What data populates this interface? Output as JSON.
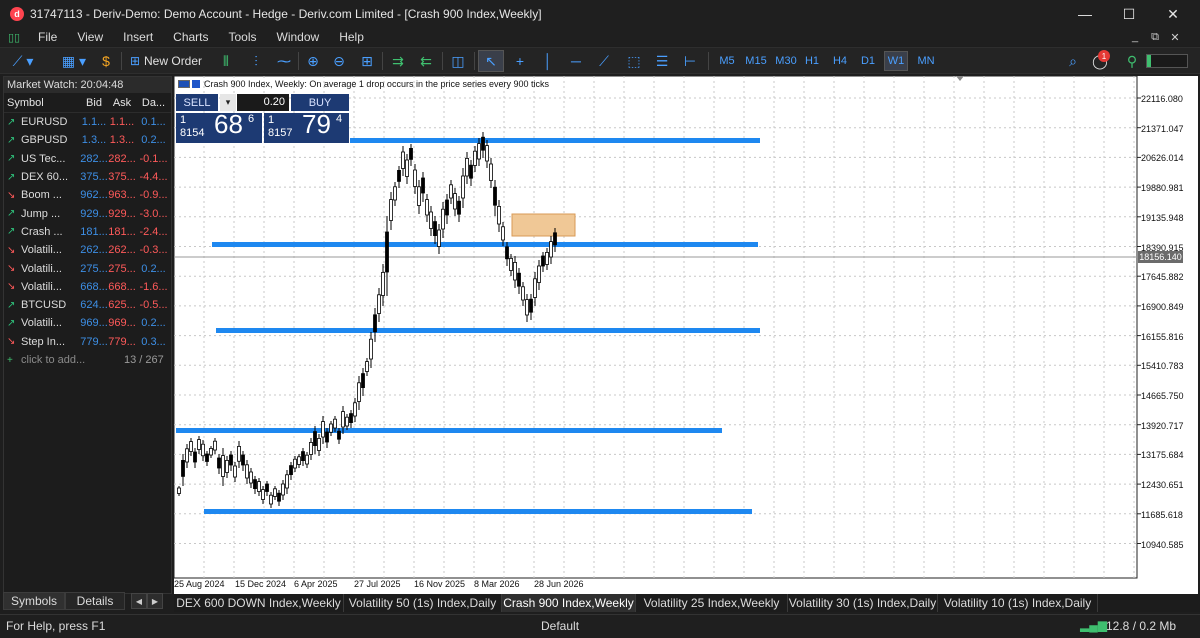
{
  "window": {
    "title": "31747113 - Deriv-Demo: Demo Account - Hedge - Deriv.com Limited - [Crash 900 Index,Weekly]",
    "logo": "d",
    "minimize": "—",
    "maximize": "☐",
    "close": "✕"
  },
  "menu": {
    "items": [
      "File",
      "View",
      "Insert",
      "Charts",
      "Tools",
      "Window",
      "Help"
    ],
    "mdi_minimize": "_",
    "mdi_restore": "⧉",
    "mdi_close": "✕"
  },
  "toolbar": {
    "new_order_label": "New Order",
    "timeframes": [
      "M5",
      "M15",
      "M30",
      "H1",
      "H4",
      "D1",
      "W1",
      "MN"
    ],
    "active_timeframe": "W1",
    "notification_count": "1"
  },
  "market_watch": {
    "title": "Market Watch: 20:04:48",
    "columns": [
      "Symbol",
      "Bid",
      "Ask",
      "Da..."
    ],
    "rows": [
      {
        "symbol": "EURUSD",
        "bid": "1.1...",
        "ask": "1.1...",
        "daily": "0.1...",
        "dir": "up"
      },
      {
        "symbol": "GBPUSD",
        "bid": "1.3...",
        "ask": "1.3...",
        "daily": "0.2...",
        "dir": "up"
      },
      {
        "symbol": "US Tec...",
        "bid": "282...",
        "ask": "282...",
        "daily": "-0.1...",
        "dir": "up"
      },
      {
        "symbol": "DEX 60...",
        "bid": "375...",
        "ask": "375...",
        "daily": "-4.4...",
        "dir": "up"
      },
      {
        "symbol": "Boom ...",
        "bid": "962...",
        "ask": "963...",
        "daily": "-0.9...",
        "dir": "down"
      },
      {
        "symbol": "Jump ...",
        "bid": "929...",
        "ask": "929...",
        "daily": "-3.0...",
        "dir": "up"
      },
      {
        "symbol": "Crash ...",
        "bid": "181...",
        "ask": "181...",
        "daily": "-2.4...",
        "dir": "up"
      },
      {
        "symbol": "Volatili...",
        "bid": "262...",
        "ask": "262...",
        "daily": "-0.3...",
        "dir": "down"
      },
      {
        "symbol": "Volatili...",
        "bid": "275...",
        "ask": "275...",
        "daily": "0.2...",
        "dir": "down"
      },
      {
        "symbol": "Volatili...",
        "bid": "668...",
        "ask": "668...",
        "daily": "-1.6...",
        "dir": "down"
      },
      {
        "symbol": "BTCUSD",
        "bid": "624...",
        "ask": "625...",
        "daily": "-0.5...",
        "dir": "up"
      },
      {
        "symbol": "Volatili...",
        "bid": "969...",
        "ask": "969...",
        "daily": "0.2...",
        "dir": "up"
      },
      {
        "symbol": "Step In...",
        "bid": "779...",
        "ask": "779...",
        "daily": "0.3...",
        "dir": "down"
      }
    ],
    "add_symbol": "click to add...",
    "count": "13 / 267",
    "tabs": [
      "Symbols",
      "Details"
    ]
  },
  "chart": {
    "info": "Crash 900 Index, Weekly:  On average 1 drop occurs in the price series every 900 ticks",
    "sell_label": "SELL",
    "buy_label": "BUY",
    "volume": "0.20",
    "sell_price": {
      "small_top": "1",
      "small_bottom": "8154",
      "big": "68",
      "sup": "6"
    },
    "buy_price": {
      "small_top": "1",
      "small_bottom": "8157",
      "big": "79",
      "sup": "4"
    },
    "current_price": "18156.140",
    "price_levels": [
      "22116.080",
      "21371.047",
      "20626.014",
      "19880.981",
      "19135.948",
      "18390.915",
      "17645.882",
      "16900.849",
      "16155.816",
      "15410.783",
      "14665.750",
      "13920.717",
      "13175.684",
      "12430.651",
      "11685.618",
      "10940.585"
    ],
    "dates": [
      "25 Aug 2024",
      "15 Dec 2024",
      "6 Apr 2025",
      "27 Jul 2025",
      "16 Nov 2025",
      "8 Mar 2026",
      "28 Jun 2026"
    ],
    "colors": {
      "level_line": "#1e88f0",
      "zone": "#f0c896",
      "candle": "#000000"
    }
  },
  "chart_tabs": [
    "DEX 600 DOWN Index,Weekly",
    "Volatility 50 (1s) Index,Daily",
    "Crash 900 Index,Weekly",
    "Volatility 25 Index,Weekly",
    "Volatility 30 (1s) Index,Daily",
    "Volatility 10 (1s) Index,Daily"
  ],
  "active_chart_tab": "Crash 900 Index,Weekly",
  "status": {
    "help": "For Help, press F1",
    "profile": "Default",
    "traffic": "12.8 / 0.2 Mb"
  }
}
